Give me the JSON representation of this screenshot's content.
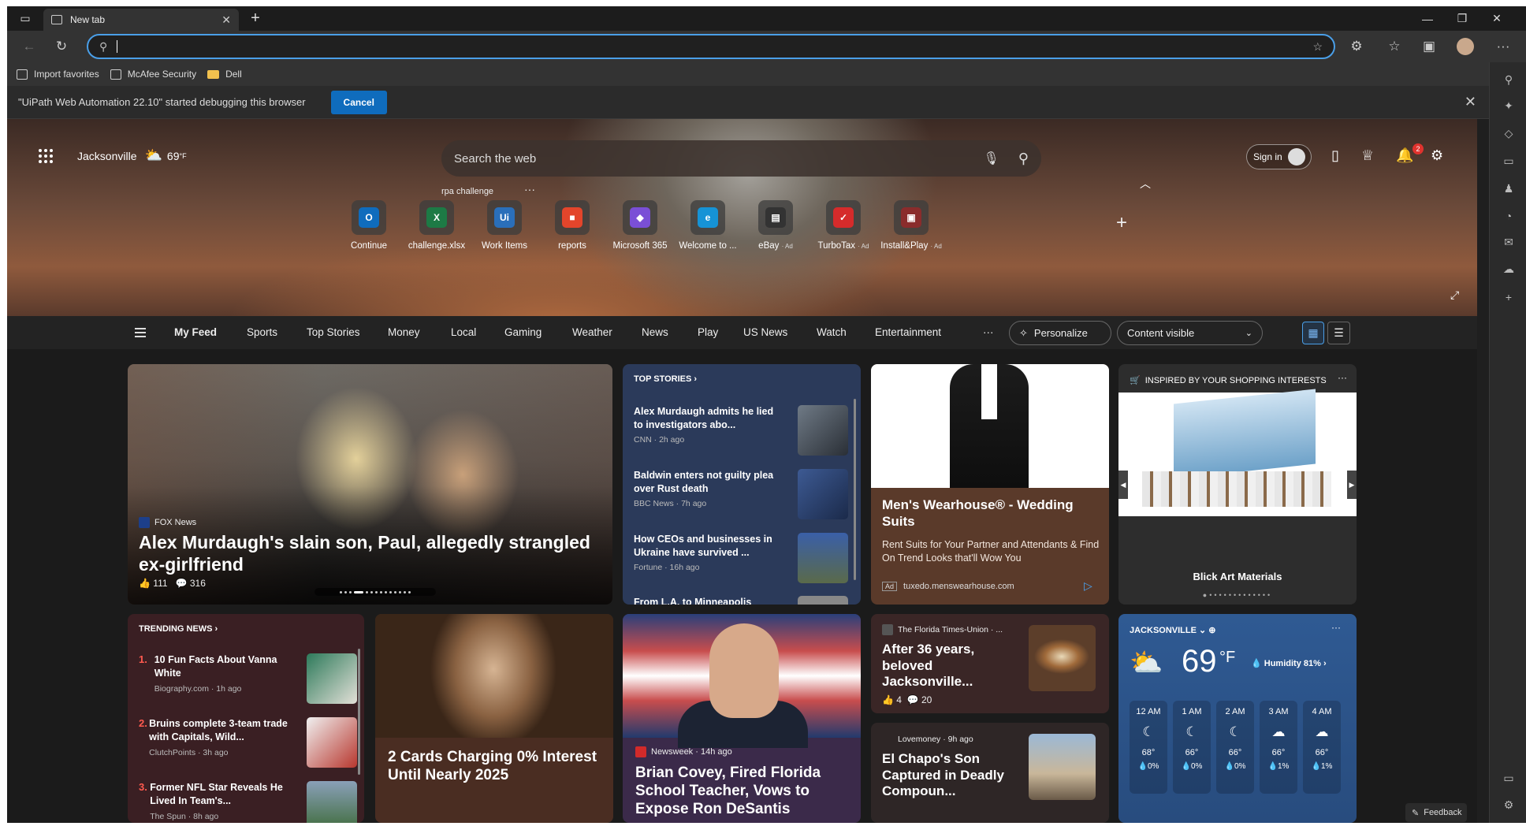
{
  "titlebar": {
    "tab_title": "New tab",
    "new_tab": "+",
    "minimize": "—",
    "restore": "❐",
    "close": "✕"
  },
  "navbar": {
    "address_value": ""
  },
  "bookmarks": [
    {
      "label": "Import favorites"
    },
    {
      "label": "McAfee Security"
    },
    {
      "label": "Dell"
    }
  ],
  "debug_bar": {
    "message": "\"UiPath Web Automation 22.10\" started debugging this browser",
    "cancel_label": "Cancel"
  },
  "header": {
    "location": "Jacksonville",
    "temp": "69",
    "temp_unit": "°F",
    "search_placeholder": "Search the web",
    "recent_search": "rpa challenge",
    "sign_in": "Sign in",
    "notification_count": "2"
  },
  "quick_links": [
    {
      "label": "Continue",
      "ad": "",
      "color": "#0f6cbd",
      "glyph": "O"
    },
    {
      "label": "challenge.xlsx",
      "ad": "",
      "color": "#1d7a45",
      "glyph": "X"
    },
    {
      "label": "Work Items",
      "ad": "",
      "color": "#2a6fba",
      "glyph": "Ui"
    },
    {
      "label": "reports",
      "ad": "",
      "color": "#e3452b",
      "glyph": "■"
    },
    {
      "label": "Microsoft 365",
      "ad": "",
      "color": "#7a4fd6",
      "glyph": "◆"
    },
    {
      "label": "Welcome to ...",
      "ad": "",
      "color": "#1693d6",
      "glyph": "e"
    },
    {
      "label": "eBay",
      "ad": "· Ad",
      "color": "#333333",
      "glyph": "▤"
    },
    {
      "label": "TurboTax",
      "ad": "· Ad",
      "color": "#d52b2b",
      "glyph": "✓"
    },
    {
      "label": "Install&Play",
      "ad": "· Ad",
      "color": "#8a2c2c",
      "glyph": "▣"
    }
  ],
  "feed_nav": {
    "items": [
      "My Feed",
      "Sports",
      "Top Stories",
      "Money",
      "Local",
      "Gaming",
      "Weather",
      "News",
      "Play",
      "US News",
      "Watch",
      "Entertainment"
    ],
    "more": "···",
    "personalize": "Personalize",
    "content_visible": "Content visible"
  },
  "hero_story": {
    "source": "FOX News",
    "headline": "Alex Murdaugh's slain son, Paul, allegedly strangled ex-girlfriend",
    "likes": "111",
    "comments": "316"
  },
  "top_stories": {
    "title": "TOP STORIES",
    "items": [
      {
        "headline": "Alex Murdaugh admits he lied to investigators abo...",
        "meta": "CNN · 2h ago"
      },
      {
        "headline": "Baldwin enters not guilty plea over Rust death",
        "meta": "BBC News · 7h ago"
      },
      {
        "headline": "How CEOs and businesses in Ukraine have survived ...",
        "meta": "Fortune · 16h ago"
      },
      {
        "headline": "From L.A. to Minneapolis",
        "meta": ""
      }
    ]
  },
  "wearhouse_ad": {
    "headline": "Men's Wearhouse® - Wedding Suits",
    "body": "Rent Suits for Your Partner and Attendants & Find On Trend Looks that'll Wow You",
    "ad_label": "Ad",
    "url": "tuxedo.menswearhouse.com"
  },
  "shopping": {
    "title": "INSPIRED BY YOUR SHOPPING INTERESTS",
    "product": "Blick Art Materials"
  },
  "trending": {
    "title": "TRENDING NEWS",
    "items": [
      {
        "num": "1.",
        "headline": "10 Fun Facts About Vanna White",
        "meta": "Biography.com · 1h ago"
      },
      {
        "num": "2.",
        "headline": "Bruins complete 3-team trade with Capitals, Wild...",
        "meta": "ClutchPoints · 3h ago"
      },
      {
        "num": "3.",
        "headline": "Former NFL Star Reveals He Lived In Team's...",
        "meta": "The Spun · 8h ago"
      }
    ]
  },
  "cards_story": {
    "headline": "2 Cards Charging 0% Interest Until Nearly 2025"
  },
  "desantis_story": {
    "source": "Newsweek",
    "time": "14h ago",
    "headline": "Brian Covey, Fired Florida School Teacher, Vows to Expose Ron DeSantis"
  },
  "jax_story": {
    "source": "The Florida Times-Union · ...",
    "headline": "After 36 years, beloved Jacksonville...",
    "likes": "4",
    "comments": "20"
  },
  "chapo_story": {
    "source": "Lovemoney · 9h ago",
    "headline": "El Chapo's Son Captured in Deadly Compoun..."
  },
  "weather": {
    "city": "JACKSONVILLE",
    "temp": "69",
    "unit": "°F",
    "humidity": "Humidity 81%",
    "hours": [
      {
        "time": "12 AM",
        "icon": "☾",
        "temp": "68°",
        "precip": "0%"
      },
      {
        "time": "1 AM",
        "icon": "☾",
        "temp": "66°",
        "precip": "0%"
      },
      {
        "time": "2 AM",
        "icon": "☾",
        "temp": "66°",
        "precip": "0%"
      },
      {
        "time": "3 AM",
        "icon": "☁",
        "temp": "66°",
        "precip": "1%"
      },
      {
        "time": "4 AM",
        "icon": "☁",
        "temp": "66°",
        "precip": "1%"
      }
    ]
  },
  "feedback": "Feedback"
}
